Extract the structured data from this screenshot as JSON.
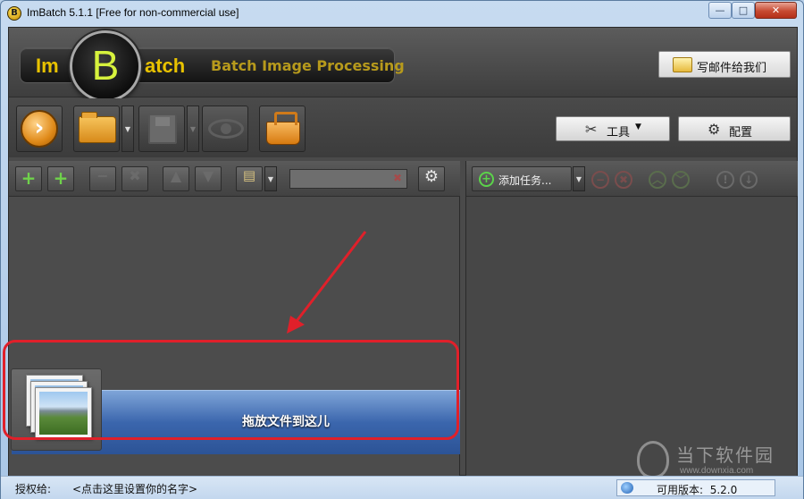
{
  "window": {
    "title": "ImBatch 5.1.1 [Free for non-commercial use]",
    "app_icon_letter": "B",
    "minimize_glyph": "—",
    "maximize_glyph": "□",
    "close_glyph": "✕"
  },
  "header": {
    "logo_im": "Im",
    "logo_b": "B",
    "logo_atch": "atch",
    "tagline": "Batch Image Processing",
    "mail_button_label": "写邮件给我们",
    "mail_icon": "envelope-icon"
  },
  "toolbar": {
    "run_icon": "run-arrow-icon",
    "run_glyph": "›",
    "open_icon": "folder-icon",
    "save_icon": "disk-icon",
    "preview_icon": "eye-icon",
    "basket_icon": "basket-icon",
    "dropdown_glyph": "▼",
    "tools_label": "工具",
    "tools_glyph": "✂",
    "tools_caret": "▼",
    "settings_label": "配置",
    "settings_glyph": "⚙"
  },
  "left_panel": {
    "buttons": {
      "add_file_glyph": "+",
      "add_folder_glyph": "+",
      "remove_glyph": "−",
      "remove_all_glyph": "✖",
      "move_up_glyph": "▲",
      "move_down_glyph": "▼",
      "filter_glyph": "▤",
      "options_glyph": "⚙"
    },
    "search": {
      "value": "",
      "clear_glyph": "✖"
    },
    "drop_zone_label": "拖放文件到这儿"
  },
  "right_panel": {
    "add_task_label": "添加任务...",
    "add_task_glyph": "+",
    "buttons": {
      "remove_glyph": "−",
      "remove_all_glyph": "✖",
      "up_glyph": "︿",
      "down_glyph": "﹀",
      "info_glyph": "!",
      "help_glyph": "↓"
    }
  },
  "statusbar": {
    "licensed_to_label": "授权给:",
    "name_placeholder": "<点击这里设置你的名字>",
    "version_label": "可用版本:",
    "version_value": "5.2.0"
  },
  "watermark": {
    "text": "当下软件园",
    "url": "www.downxia.com"
  },
  "annotation": {
    "highlight_color": "#e0202a",
    "arrow_color": "#e0202a"
  },
  "colors": {
    "accent_orange": "#e08a19",
    "logo_yellow": "#e8c200",
    "logo_green": "#d7f23d",
    "drop_zone_blue": "#3b66ad"
  }
}
